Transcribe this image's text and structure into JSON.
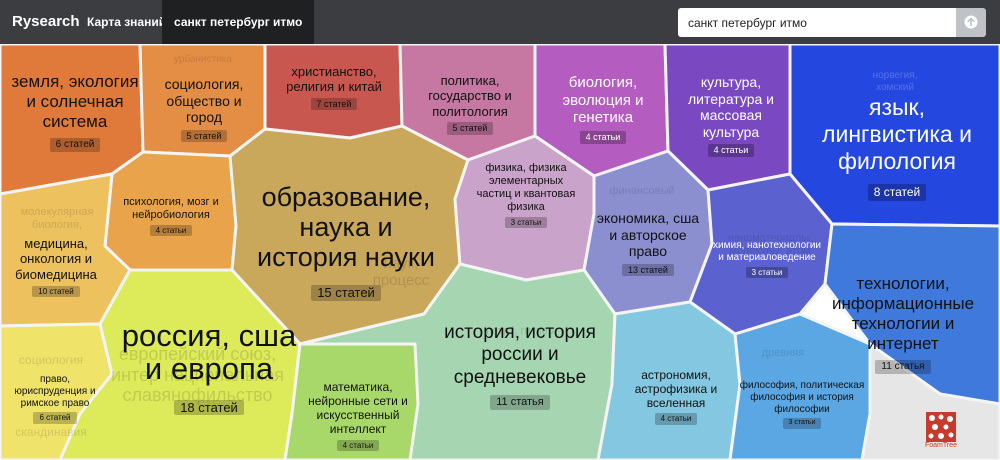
{
  "app": {
    "brand": "Rysearch"
  },
  "nav": {
    "tab_map": "Карта знаний",
    "tab_query": "санкт петербург итмо"
  },
  "search": {
    "value": "санкт петербург итмо"
  },
  "footer": {
    "logo_text": "FoamTree"
  },
  "colors": {
    "topbar": "#3b3d40",
    "active_tab": "#1f2022"
  },
  "topics": [
    {
      "label": "земля, экология и солнечная система",
      "count": "6 статей"
    },
    {
      "label": "социология, общество и город",
      "count": "5 статей"
    },
    {
      "label": "христианство, религия и китай",
      "count": "7 статей"
    },
    {
      "label": "политика, государство и политология",
      "count": "5 статей"
    },
    {
      "label": "биология, эволюция и генетика",
      "count": "4 статьи"
    },
    {
      "label": "культура, литература и массовая культура",
      "count": "4 статьи"
    },
    {
      "label": "язык, лингвистика и филология",
      "count": "8 статей"
    },
    {
      "label": "психология, мозг и нейробиология",
      "count": "4 статьи"
    },
    {
      "label": "образование, наука и история науки",
      "count": "15 статей"
    },
    {
      "label": "физика, физика элементарных частиц и квантовая физика",
      "count": "3 статьи"
    },
    {
      "label": "экономика, сша и авторское право",
      "count": "13 статей"
    },
    {
      "label": "химия, нанотехнологии и материаловедение",
      "count": "3 статьи"
    },
    {
      "label": "медицина, онкология и биомедицина",
      "count": "10 статей"
    },
    {
      "label": "технологии, информационные технологии и интернет",
      "count": "11 статья"
    },
    {
      "label": "россия, сша и европа",
      "count": "18 статей"
    },
    {
      "label": "история, история россии и средневековье",
      "count": "11 статья"
    },
    {
      "label": "право, юриспруденция и римское право",
      "count": "6 статей"
    },
    {
      "label": "математика, нейронные сети и искусственный интеллект",
      "count": "4 статьи"
    },
    {
      "label": "астрономия, астрофизика и вселенная",
      "count": "4 статьи"
    },
    {
      "label": "философия, политическая философия и история философии",
      "count": "3 статьи"
    }
  ],
  "subtopics": {
    "earth": "урбанистика",
    "molecular": "молекулярная биология,",
    "christ": "китай",
    "finance": "финансовый",
    "nanomat": "наноматериалы, молекулы, атом",
    "europe": "европейский союз, интер национальная славянофильство",
    "socio2": "социология",
    "scand": "скандинавия",
    "petr": "петр i, гитлер",
    "ancient": "древняя",
    "norway": "норвегия, хомский",
    "science_process": "наук, процесс",
    "fac": "фак",
    "bez": "без"
  }
}
